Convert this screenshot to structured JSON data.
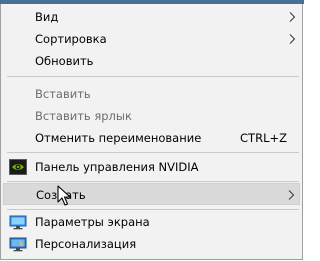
{
  "menu": {
    "view": "Вид",
    "sort": "Сортировка",
    "refresh": "Обновить",
    "paste": "Вставить",
    "paste_shortcut": "Вставить ярлык",
    "undo_rename": "Отменить переименование",
    "undo_rename_shortcut": "CTRL+Z",
    "nvidia_panel": "Панель управления NVIDIA",
    "create": "Создать",
    "display_settings": "Параметры экрана",
    "personalize": "Персонализация"
  },
  "icons": {
    "nvidia": "nvidia-icon",
    "display": "display-settings-icon",
    "personalize": "personalize-icon",
    "submenu": "chevron-right-icon"
  },
  "colors": {
    "menu_bg": "#f2f2f2",
    "highlight_bg": "#dadada",
    "disabled_text": "#6d6d6d",
    "nvidia_green": "#76b900",
    "display_blue": "#1e90ff"
  }
}
